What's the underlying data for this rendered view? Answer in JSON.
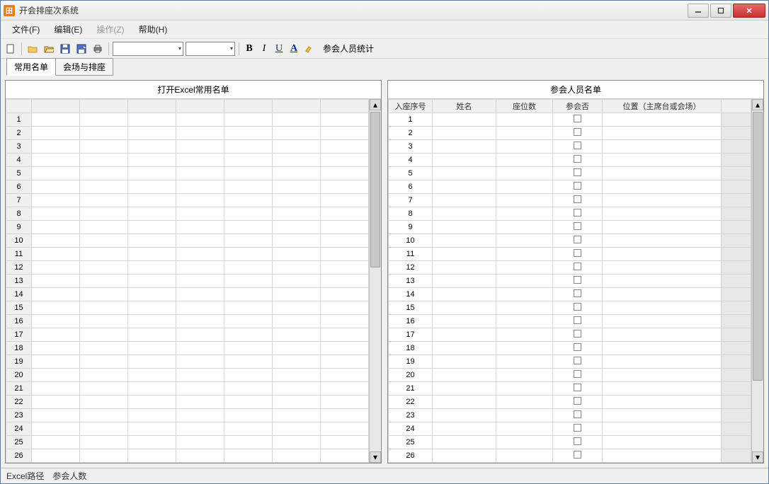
{
  "window": {
    "title": "开会排座次系统"
  },
  "menu": {
    "file": "文件(F)",
    "edit": "编辑(E)",
    "operate": "操作(Z)",
    "help": "帮助(H)"
  },
  "toolbar": {
    "stat_link": "参会人员统计"
  },
  "tabs": {
    "tab1": "常用名单",
    "tab2": "会场与排座"
  },
  "left_panel": {
    "title": "打开Excel常用名单",
    "rows": 26
  },
  "right_panel": {
    "title": "参会人员名单",
    "headers": {
      "seq": "入座序号",
      "name": "姓名",
      "seat": "座位数",
      "attend": "参会否",
      "pos": "位置（主席台或会场）"
    },
    "rows": 26
  },
  "statusbar": {
    "path": "Excel路径",
    "count": "参会人数"
  }
}
